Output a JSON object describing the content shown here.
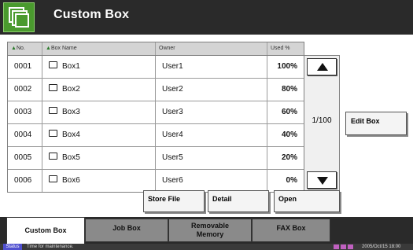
{
  "header": {
    "title": "Custom Box",
    "icon": "box-icon",
    "accent_color": "#4a9a2e"
  },
  "table": {
    "columns": [
      "No.",
      "Box Name",
      "Owner",
      "Used %"
    ],
    "rows": [
      {
        "no": "0001",
        "name": "Box1",
        "owner": "User1",
        "used": "100%"
      },
      {
        "no": "0002",
        "name": "Box2",
        "owner": "User2",
        "used": "80%"
      },
      {
        "no": "0003",
        "name": "Box3",
        "owner": "User3",
        "used": "60%"
      },
      {
        "no": "0004",
        "name": "Box4",
        "owner": "User4",
        "used": "40%"
      },
      {
        "no": "0005",
        "name": "Box5",
        "owner": "User5",
        "used": "20%"
      },
      {
        "no": "0006",
        "name": "Box6",
        "owner": "User6",
        "used": "0%"
      }
    ]
  },
  "scroll": {
    "page_indicator": "1/100"
  },
  "buttons": {
    "edit_box": "Edit Box",
    "store_file": "Store File",
    "detail": "Detail",
    "open": "Open"
  },
  "tabs": [
    {
      "label": "Custom Box"
    },
    {
      "label": "Job Box"
    },
    {
      "label_line1": "Removable",
      "label_line2": "Memory"
    },
    {
      "label": "FAX Box"
    }
  ],
  "status": {
    "label": "Status",
    "message": "Time for maintenance.",
    "datetime": "2005/Oct/15 18:00"
  }
}
